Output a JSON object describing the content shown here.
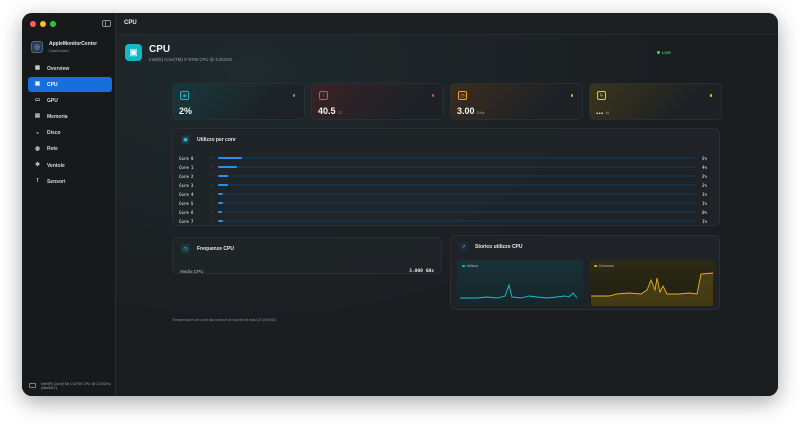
{
  "window": {
    "traffic_colors": [
      "#ff5f57",
      "#febc2e",
      "#28c840"
    ]
  },
  "sidebar": {
    "app_name": "AppleMonitorCenter",
    "app_subtitle": "Dashboard",
    "items": [
      {
        "label": "Overview",
        "icon": "grid-icon",
        "glyph": "▦"
      },
      {
        "label": "CPU",
        "icon": "cpu-icon",
        "glyph": "▣"
      },
      {
        "label": "GPU",
        "icon": "monitor-icon",
        "glyph": "▭"
      },
      {
        "label": "Memoria",
        "icon": "memory-icon",
        "glyph": "▤"
      },
      {
        "label": "Disco",
        "icon": "disk-icon",
        "glyph": "◒"
      },
      {
        "label": "Rete",
        "icon": "network-icon",
        "glyph": "◍"
      },
      {
        "label": "Ventole",
        "icon": "fan-icon",
        "glyph": "✻"
      },
      {
        "label": "Sensori",
        "icon": "thermometer-icon",
        "glyph": "⊺"
      }
    ],
    "active_index": 1,
    "footer_text": "Intel(R) Core(TM) i7-8700 CPU @ 3.20GHz (MacMLT)"
  },
  "topbar": {
    "title": "CPU"
  },
  "header": {
    "title": "CPU",
    "subtitle": "Intel(R) Core(TM) i7-8700 CPU @ 3.20GHz",
    "live_label": "LIVE"
  },
  "stats": [
    {
      "name": "usage",
      "value": "2%",
      "unit": "",
      "icon": "gauge-icon",
      "glyph": "◉",
      "color": "#17b7c4",
      "bg": "#17393d"
    },
    {
      "name": "temperature",
      "value": "40.5",
      "unit": "°C",
      "icon": "thermometer-icon",
      "glyph": "⊺",
      "color": "#e5484d",
      "bg": "#3a2125"
    },
    {
      "name": "frequency",
      "value": "3.00",
      "unit": "GHz",
      "icon": "clock-icon",
      "glyph": "◷",
      "color": "#f0a13a",
      "bg": "#3b2d1c"
    },
    {
      "name": "power",
      "value": "...",
      "unit": "W",
      "icon": "bolt-icon",
      "glyph": "ϟ",
      "color": "#f5c518",
      "bg": "#3a351a"
    }
  ],
  "cores": {
    "title": "Utilizzo per core",
    "items": [
      {
        "label": "Core 0",
        "pct": "5%",
        "value": 5
      },
      {
        "label": "Core 1",
        "pct": "4%",
        "value": 4
      },
      {
        "label": "Core 2",
        "pct": "2%",
        "value": 2
      },
      {
        "label": "Core 3",
        "pct": "2%",
        "value": 2
      },
      {
        "label": "Core 4",
        "pct": "1%",
        "value": 1
      },
      {
        "label": "Core 5",
        "pct": "1%",
        "value": 1
      },
      {
        "label": "Core 6",
        "pct": "0%",
        "value": 0
      },
      {
        "label": "Core 7",
        "pct": "1%",
        "value": 1
      }
    ]
  },
  "frequency_card": {
    "title": "Frequenze CPU",
    "row_label": "Media CPU",
    "row_value": "3.000 GHz"
  },
  "history": {
    "title": "Storico utilizzo CPU",
    "usage_label": "Utilizzo",
    "usage_color": "#17c3cf",
    "power_label": "Consumo",
    "power_color": "#e6b413"
  },
  "note": "Temperature dei core dai sensori di vcoretr di macOS (IOHID)."
}
